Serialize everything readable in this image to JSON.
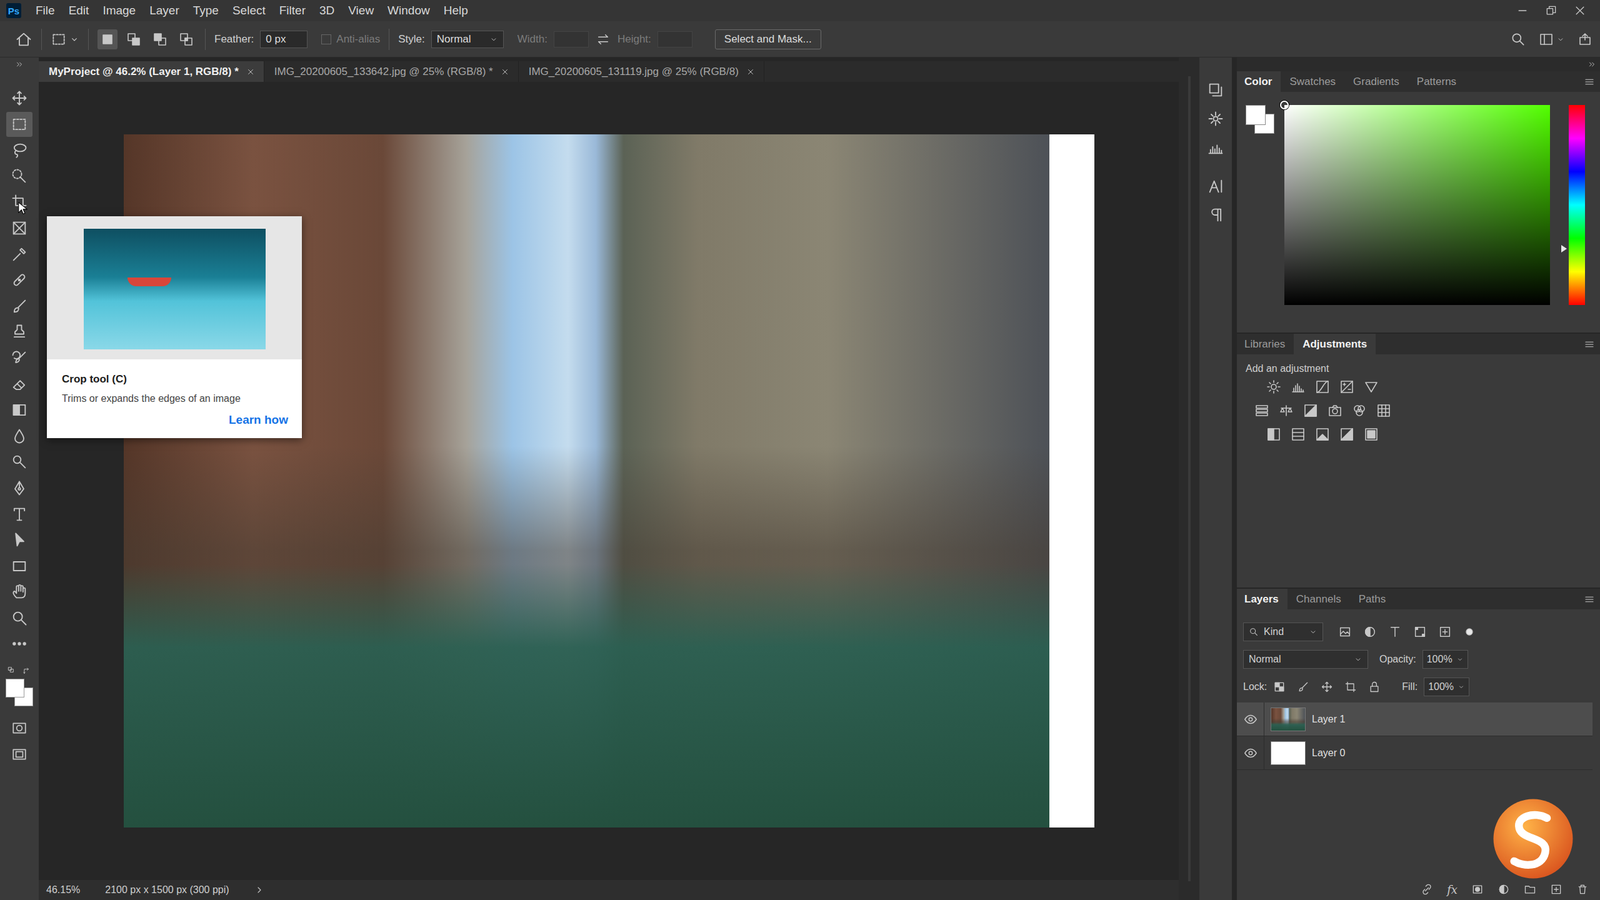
{
  "app_logo": "Ps",
  "menu": [
    "File",
    "Edit",
    "Image",
    "Layer",
    "Type",
    "Select",
    "Filter",
    "3D",
    "View",
    "Window",
    "Help"
  ],
  "options_bar": {
    "selection_modes": [
      {
        "kind": "new",
        "selected": true
      },
      {
        "kind": "add",
        "selected": false
      },
      {
        "kind": "subtract",
        "selected": false
      },
      {
        "kind": "intersect",
        "selected": false
      }
    ],
    "feather_label": "Feather:",
    "feather_value": "0 px",
    "anti_alias": {
      "label": "Anti-alias",
      "checked": false,
      "disabled": true
    },
    "style_label": "Style:",
    "style_value": "Normal",
    "width_label": "Width:",
    "height_label": "Height:",
    "size_fields_disabled": true,
    "select_and_mask": "Select and Mask..."
  },
  "tabs": [
    {
      "label": "MyProject @ 46.2% (Layer 1, RGB/8) *",
      "selected": true
    },
    {
      "label": "IMG_20200605_133642.jpg @ 25% (RGB/8) *",
      "selected": false
    },
    {
      "label": "IMG_20200605_131119.jpg @ 25% (RGB/8)",
      "selected": false
    }
  ],
  "tools": [
    {
      "kind": "move",
      "selected": false
    },
    {
      "kind": "marquee",
      "selected": true
    },
    {
      "kind": "lasso",
      "selected": false
    },
    {
      "kind": "quick-select",
      "selected": false
    },
    {
      "kind": "crop",
      "selected": false
    },
    {
      "kind": "frame",
      "selected": false
    },
    {
      "kind": "eyedropper",
      "selected": false
    },
    {
      "kind": "healing",
      "selected": false
    },
    {
      "kind": "brush",
      "selected": false
    },
    {
      "kind": "stamp",
      "selected": false
    },
    {
      "kind": "history-brush",
      "selected": false
    },
    {
      "kind": "eraser",
      "selected": false
    },
    {
      "kind": "gradient",
      "selected": false
    },
    {
      "kind": "blur",
      "selected": false
    },
    {
      "kind": "dodge",
      "selected": false
    },
    {
      "kind": "pen",
      "selected": false
    },
    {
      "kind": "type",
      "selected": false
    },
    {
      "kind": "path-select",
      "selected": false
    },
    {
      "kind": "rectangle",
      "selected": false
    },
    {
      "kind": "hand",
      "selected": false
    },
    {
      "kind": "zoom",
      "selected": false
    },
    {
      "kind": "more",
      "selected": false
    }
  ],
  "tooltip": {
    "title": "Crop tool (C)",
    "description": "Trims or expands the edges of an image",
    "link": "Learn how"
  },
  "status_bar": {
    "zoom": "46.15%",
    "document": "2100 px x 1500 px (300 ppi)"
  },
  "color_panel": {
    "tabs": [
      {
        "label": "Color",
        "selected": true
      },
      {
        "label": "Swatches",
        "selected": false
      },
      {
        "label": "Gradients",
        "selected": false
      },
      {
        "label": "Patterns",
        "selected": false
      }
    ],
    "foreground": "#ffffff",
    "background": "#ffffff",
    "hue_level": 0.72,
    "saturation": 0,
    "brightness": 1
  },
  "adjustments_panel": {
    "tabs": [
      {
        "label": "Libraries",
        "selected": false
      },
      {
        "label": "Adjustments",
        "selected": true
      }
    ],
    "heading": "Add an adjustment"
  },
  "layers_panel": {
    "tabs": [
      {
        "label": "Layers",
        "selected": true
      },
      {
        "label": "Channels",
        "selected": false
      },
      {
        "label": "Paths",
        "selected": false
      }
    ],
    "filter": "Kind",
    "blend_mode": "Normal",
    "opacity_label": "Opacity:",
    "opacity": "100%",
    "lock_label": "Lock:",
    "fill_label": "Fill:",
    "fill": "100%",
    "fx_label": "fx",
    "layers": [
      {
        "name": "Layer 1",
        "visible": true,
        "selected": true,
        "kind": "photo"
      },
      {
        "name": "Layer 0",
        "visible": true,
        "selected": false,
        "kind": "fill"
      }
    ]
  }
}
